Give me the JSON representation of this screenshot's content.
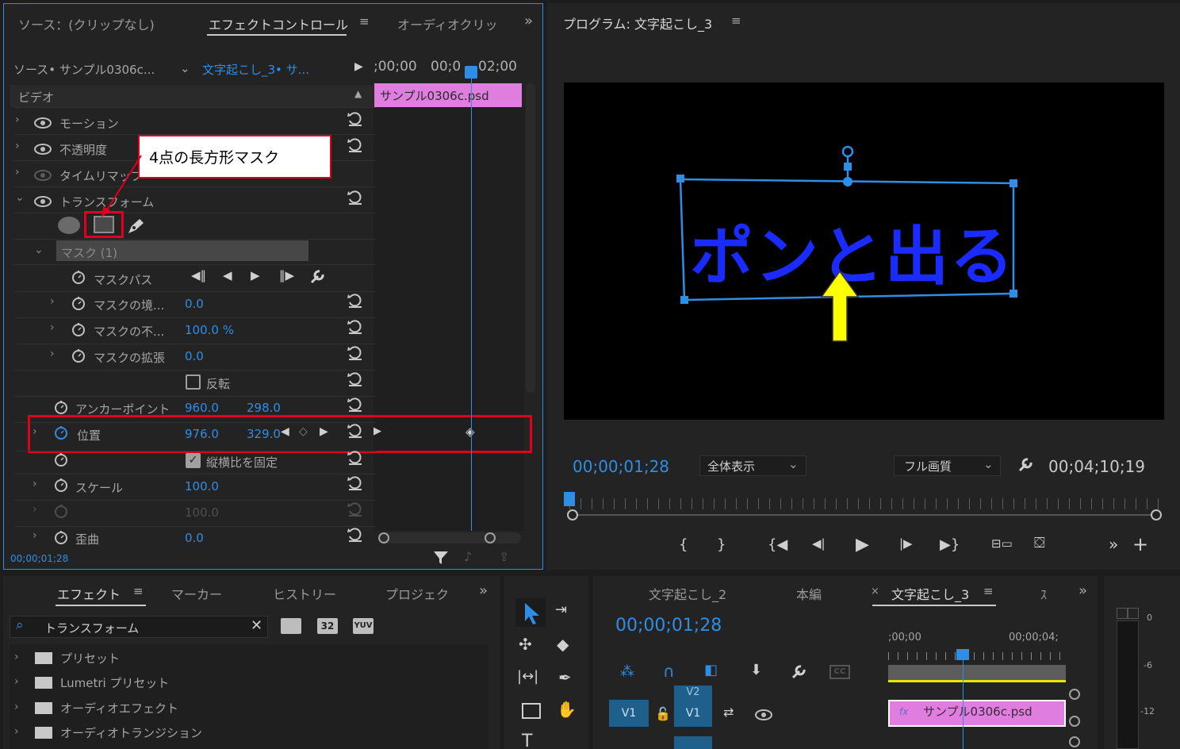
{
  "effect_controls": {
    "tabs": [
      "ソース：(クリップなし)",
      "エフェクトコントロール",
      "オーディオクリッ"
    ],
    "source_label": "ソース• サンプル0306c...",
    "sequence_label": "文字起こし_3• サ...",
    "time_ruler": [
      ";00;00",
      "00;0",
      "02;00"
    ],
    "clip_name": "サンプル0306c.psd",
    "video_header": "ビデオ",
    "rows": {
      "motion": "モーション",
      "opacity": "不透明度",
      "time_remap": "タイムリマップ",
      "transform": "トランスフォーム",
      "mask": "マスク (1)",
      "mask_path": "マスクパス",
      "mask_feather": "マスクの境...",
      "mask_feather_val": "0.0",
      "mask_opacity": "マスクの不...",
      "mask_opacity_val": "100.0 %",
      "mask_expansion": "マスクの拡張",
      "mask_expansion_val": "0.0",
      "inverted": "反転",
      "anchor": "アンカーポイント",
      "anchor_x": "960.0",
      "anchor_y": "298.0",
      "position": "位置",
      "position_x": "976.0",
      "position_y": "329.0",
      "uniform_scale": "縦横比を固定",
      "scale": "スケール",
      "scale_val": "100.0",
      "scale_w_val": "100.0",
      "skew": "歪曲",
      "skew_val": "0.0"
    },
    "timecode": "00;00;01;28"
  },
  "callout": {
    "text": "4点の長方形マスク"
  },
  "program": {
    "title": "プログラム: 文字起こし_3",
    "overlay_text": "ポンと出る",
    "timecode": "00;00;01;28",
    "zoom": "全体表示",
    "quality": "フル画質",
    "duration": "00;04;10;19"
  },
  "effects_panel": {
    "tabs": [
      "エフェクト",
      "マーカー",
      "ヒストリー",
      "プロジェク"
    ],
    "search_value": "トランスフォーム",
    "badges": [
      "32",
      "YUV"
    ],
    "items": [
      "プリセット",
      "Lumetri プリセット",
      "オーディオエフェクト",
      "オーディオトランジション"
    ]
  },
  "timeline": {
    "tabs": [
      "文字起こし_2",
      "本編",
      "文字起こし_3",
      "ｽ"
    ],
    "timecode": "00;00;01;28",
    "ruler": [
      ";00;00",
      "00;00;04;"
    ],
    "tracks": [
      "V2",
      "V1",
      "V1"
    ],
    "clip": "サンプル0306c.psd"
  },
  "meter": {
    "labels": [
      "0",
      "-6",
      "-12"
    ]
  },
  "colors": {
    "accent": "#2e8ee6",
    "clip_pink": "#e07ee0",
    "callout_red": "#e0001c",
    "arrow_yellow": "#ffff00"
  }
}
